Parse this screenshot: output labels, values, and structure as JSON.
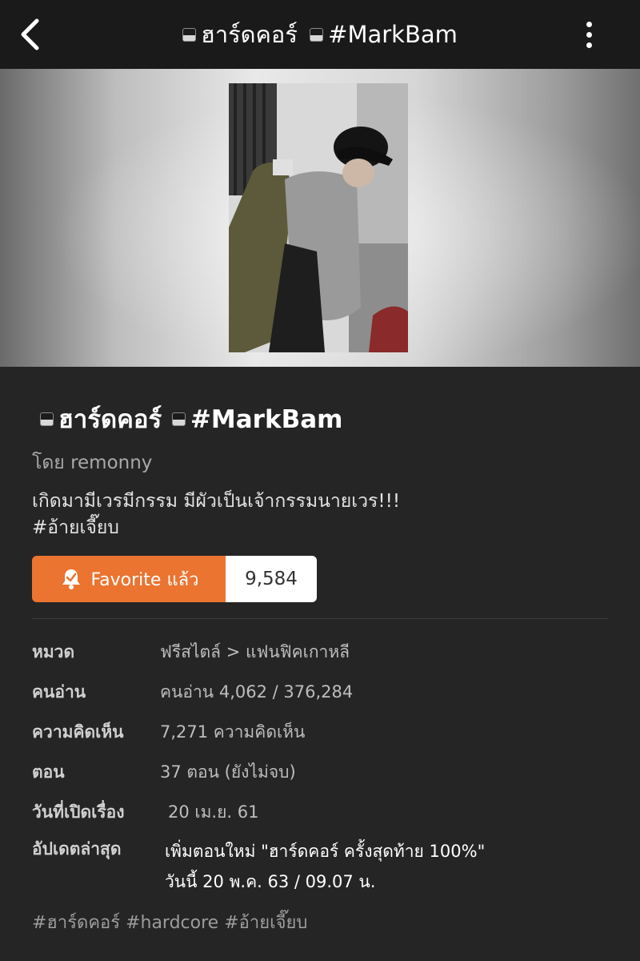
{
  "header": {
    "title": "#MarkBam",
    "title_prefix": "ฮาร์ดคอร์",
    "back_icon": "chevron-left-icon",
    "more_icon": "vertical-ellipsis-icon"
  },
  "story": {
    "title_part1": "ฮาร์ดคอร์",
    "title_part2": "#MarkBam",
    "author": "โดย remonny",
    "description_line1": "เกิดมามีเวรมีกรรม มีผัวเป็นเจ้ากรรมนายเวร!!!",
    "description_line2": "#อ้ายเจี๊ยบ",
    "favorite_label": "Favorite แล้ว",
    "favorite_icon": "bell-check-icon",
    "favorite_count": "9,584",
    "accent_color": "#ea7430"
  },
  "info": {
    "category_label": "หมวด",
    "category_value": "ฟรีสไตล์ > แฟนฟิคเกาหลี",
    "readers_label": "คนอ่าน",
    "readers_value": "คนอ่าน 4,062 / 376,284",
    "comments_label": "ความคิดเห็น",
    "comments_value": "7,271 ความคิดเห็น",
    "episodes_label": "ตอน",
    "episodes_value": "37 ตอน (ยังไม่จบ)",
    "opened_label": "วันที่เปิดเรื่อง",
    "opened_value": "20 เม.ย. 61",
    "updated_label": "อัปเดตล่าสุด",
    "updated_value_line1": "เพิ่มตอนใหม่ \"ฮาร์ดคอร์ ครั้งสุดท้าย 100%\"",
    "updated_value_line2": "วันนี้ 20 พ.ค. 63 / 09.07 น."
  },
  "tags": [
    "#ฮาร์ดคอร์",
    "#hardcore",
    "#อ้ายเจี๊ยบ"
  ]
}
